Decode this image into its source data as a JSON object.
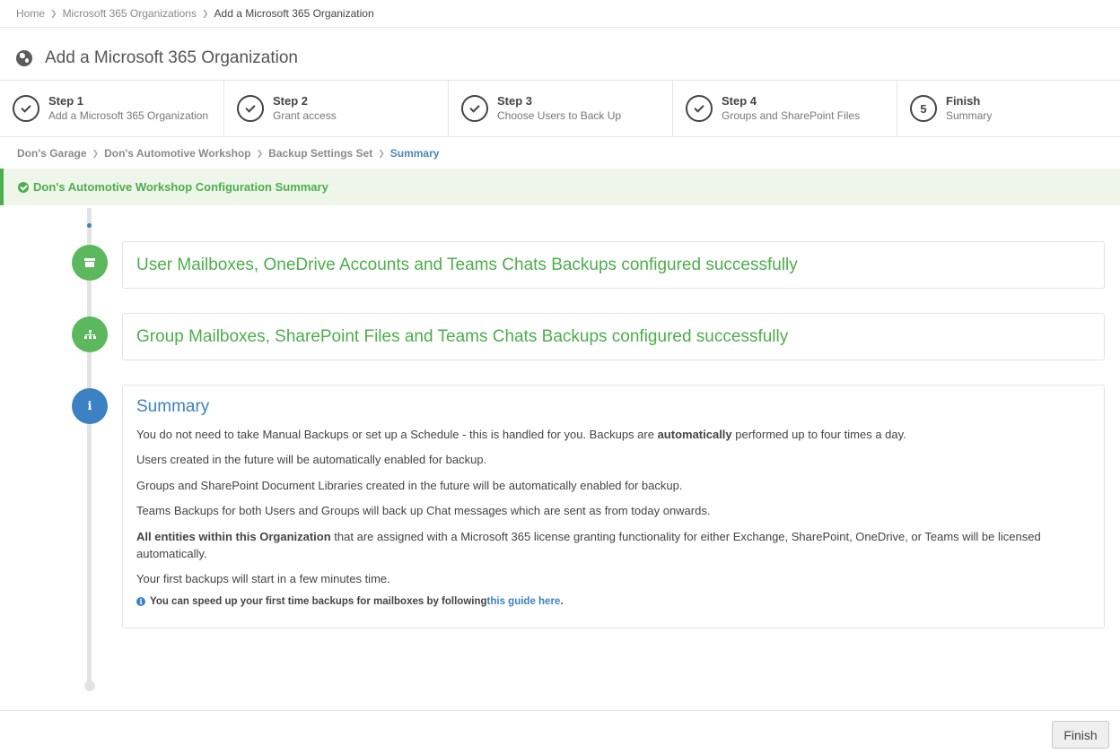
{
  "breadcrumb": {
    "items": [
      "Home",
      "Microsoft 365 Organizations",
      "Add a Microsoft 365 Organization"
    ]
  },
  "page": {
    "title": "Add a Microsoft 365 Organization",
    "icon": "globe-icon"
  },
  "steps": [
    {
      "title": "Step 1",
      "subtitle": "Add a Microsoft 365 Organization",
      "state": "complete"
    },
    {
      "title": "Step 2",
      "subtitle": "Grant access",
      "state": "complete"
    },
    {
      "title": "Step 3",
      "subtitle": "Choose Users to Back Up",
      "state": "complete"
    },
    {
      "title": "Step 4",
      "subtitle": "Groups and SharePoint Files",
      "state": "complete"
    },
    {
      "title": "Finish",
      "subtitle": "Summary",
      "number": "5",
      "state": "current"
    }
  ],
  "sub_breadcrumb": {
    "items": [
      "Don's Garage",
      "Don's Automotive Workshop",
      "Backup Settings Set",
      "Summary"
    ]
  },
  "alert": {
    "text": "Don's Automotive Workshop Configuration Summary",
    "color": "#4cae4c"
  },
  "timeline": {
    "items": [
      {
        "title": "User Mailboxes, OneDrive Accounts and Teams Chats Backups configured successfully",
        "icon": "archive-icon",
        "color": "#5cb85c"
      },
      {
        "title": "Group Mailboxes, SharePoint Files and Teams Chats Backups configured successfully",
        "icon": "sitemap-icon",
        "color": "#5cb85c"
      }
    ],
    "summary": {
      "icon": "info-icon",
      "color": "#3b81c4",
      "title": "Summary",
      "p1_before": "You do not need to take Manual Backups or set up a Schedule - this is handled for you. Backups are ",
      "p1_bold": "automatically",
      "p1_after": " performed up to four times a day.",
      "p2": "Users created in the future will be automatically enabled for backup.",
      "p3": "Groups and SharePoint Document Libraries created in the future will be automatically enabled for backup.",
      "p4": "Teams Backups for both Users and Groups will back up Chat messages which are sent as from today onwards.",
      "p5_bold": "All entities within this Organization",
      "p5_after": " that are assigned with a Microsoft 365 license granting functionality for either Exchange, SharePoint, OneDrive, or Teams will be licensed automatically.",
      "p6": "Your first backups will start in a few minutes time.",
      "note_before": "You can speed up your first time backups for mailboxes by following ",
      "note_link": "this guide here",
      "note_after": "."
    }
  },
  "footer": {
    "finish_label": "Finish"
  }
}
